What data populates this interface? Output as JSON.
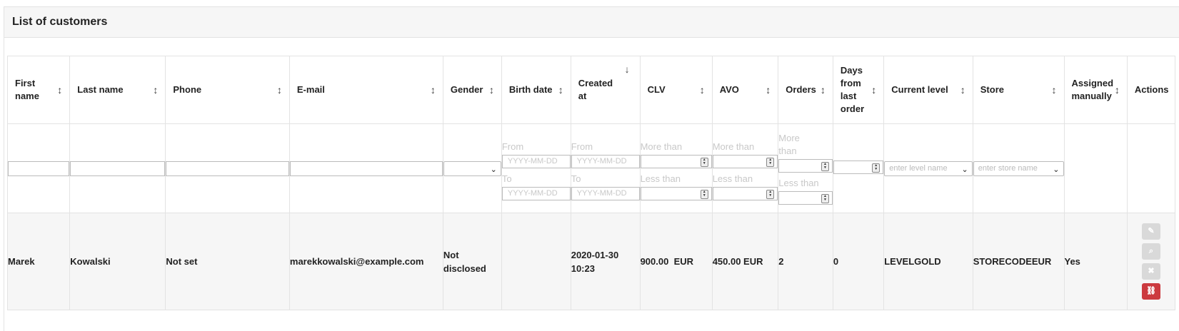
{
  "panel": {
    "title": "List of customers"
  },
  "columns": [
    {
      "label": "First name",
      "sort_icon": "sort-icon",
      "sort_glyph": "↕"
    },
    {
      "label": "Last name",
      "sort_icon": "sort-icon",
      "sort_glyph": "↕"
    },
    {
      "label": "Phone",
      "sort_icon": "sort-icon",
      "sort_glyph": "↕"
    },
    {
      "label": "E-mail",
      "sort_icon": "sort-icon",
      "sort_glyph": "↕"
    },
    {
      "label": "Gender",
      "sort_icon": "sort-icon",
      "sort_glyph": "↕"
    },
    {
      "label": "Birth date",
      "sort_icon": "sort-icon",
      "sort_glyph": "↕"
    },
    {
      "label": "Created at",
      "sort_icon": "sort-desc-icon",
      "sort_glyph": "↓"
    },
    {
      "label": "CLV",
      "sort_icon": "sort-icon",
      "sort_glyph": "↕"
    },
    {
      "label": "AVO",
      "sort_icon": "sort-icon",
      "sort_glyph": "↕"
    },
    {
      "label": "Orders",
      "sort_icon": "sort-icon",
      "sort_glyph": "↕"
    },
    {
      "label": "Days from last order",
      "sort_icon": "sort-icon",
      "sort_glyph": "↕"
    },
    {
      "label": "Current level",
      "sort_icon": "sort-icon",
      "sort_glyph": "↕"
    },
    {
      "label": "Store",
      "sort_icon": "sort-icon",
      "sort_glyph": "↕"
    },
    {
      "label": "Assigned manually",
      "sort_icon": "sort-icon",
      "sort_glyph": "↕"
    },
    {
      "label": "Actions"
    }
  ],
  "filters": {
    "first_name": "",
    "last_name": "",
    "phone": "",
    "email": "",
    "gender": "",
    "from_label": "From",
    "to_label": "To",
    "date_placeholder": "YYYY-MM-DD",
    "more_than_label": "More than",
    "less_than_label": "Less than",
    "orders_more_label": "More than",
    "level_placeholder": "enter level name",
    "store_placeholder": "enter store name"
  },
  "rows": [
    {
      "first_name": "Marek",
      "last_name": "Kowalski",
      "phone": "Not set",
      "email": "marekkowalski@example.com",
      "gender": "Not disclosed",
      "birth_date": "",
      "created_at": "2020-01-30 10:23",
      "clv": "900.00  EUR",
      "avo": "450.00 EUR",
      "orders": "2",
      "days_from_last_order": "0",
      "current_level": "LEVELGOLD",
      "store": "STORECODEEUR",
      "assigned_manually": "Yes"
    }
  ],
  "actions": [
    {
      "name": "edit-icon",
      "glyph": "✎",
      "color": "#d9d9d9"
    },
    {
      "name": "view-icon",
      "glyph": "⌕",
      "color": "#d9d9d9"
    },
    {
      "name": "delete-icon",
      "glyph": "✖",
      "color": "#d9d9d9"
    },
    {
      "name": "unlink-icon",
      "glyph": "⛓",
      "color": "#cc3a3f"
    }
  ]
}
